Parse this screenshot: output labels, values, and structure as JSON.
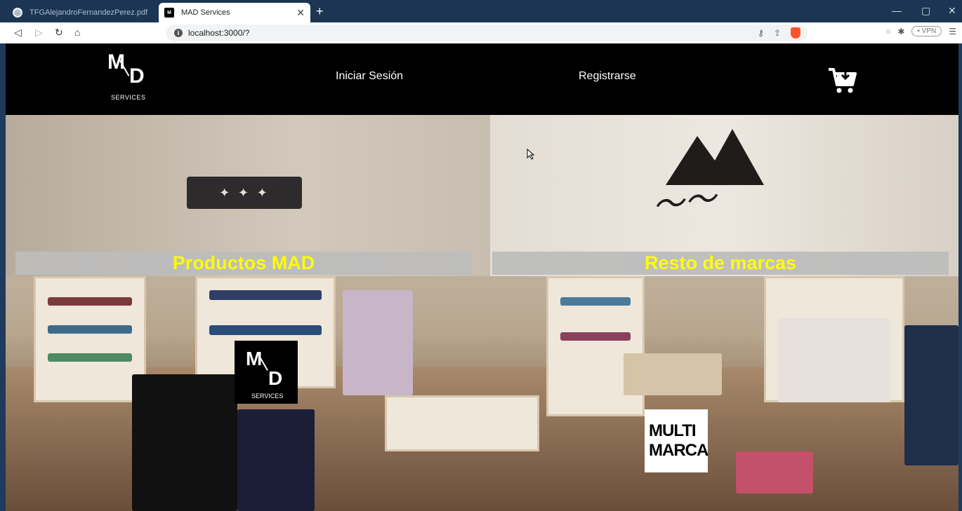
{
  "browser": {
    "tabs": [
      {
        "title": "TFGAlejandroFernandezPerez.pdf",
        "favicon": "globe-icon",
        "active": false
      },
      {
        "title": "MAD Services",
        "favicon": "md-logo-icon",
        "active": true
      }
    ],
    "new_tab": "+",
    "url": "localhost:3000/?",
    "vpn_label": "VPN"
  },
  "header": {
    "logo": {
      "m": "M",
      "d": "D",
      "tagline": "SERVICES"
    },
    "login": "Iniciar Sesión",
    "register": "Registrarse",
    "cart_icon": "cart-icon"
  },
  "hero": {
    "left_category": "Productos MAD",
    "right_category": "Resto de marcas",
    "left_card": {
      "m": "M",
      "d": "D",
      "tagline": "SERVICES"
    },
    "right_card": {
      "line1": "MULTI",
      "line2": "MARCA"
    },
    "accent_color": "#ffff00",
    "bar_color": "#bdbdbd"
  }
}
